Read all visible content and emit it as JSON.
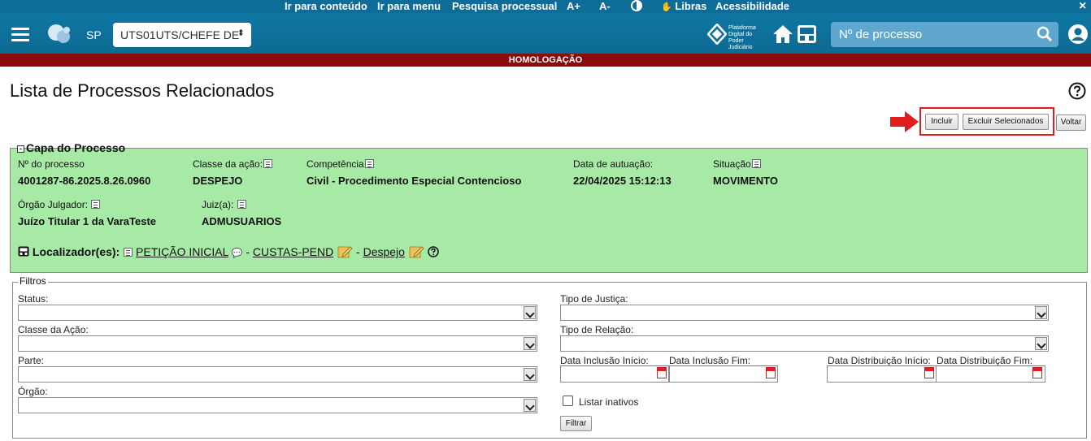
{
  "topnav": {
    "skip_content": "Ir para conteúdo",
    "skip_menu": "Ir para menu",
    "search_process": "Pesquisa processual",
    "font_increase": "A+",
    "font_decrease": "A-",
    "libras": "Libras",
    "accessibility": "Acessibilidade",
    "close": "×"
  },
  "header": {
    "state": "SP",
    "profile_select": "UTS01UTS/CHEFE DE",
    "pdpj_text": "Plataforma Digital do Poder Judiciário",
    "search_placeholder": "Nº de processo"
  },
  "banner": "HOMOLOGAÇÃO",
  "page": {
    "title": "Lista de Processos Relacionados"
  },
  "actions": {
    "include": "Incluir",
    "delete_selected": "Excluir Selecionados",
    "back": "Voltar"
  },
  "capa": {
    "legend": "Capa do Processo",
    "numero_label": "Nº do processo",
    "numero": "4001287-86.2025.8.26.0960",
    "classe_label": "Classe da ação:",
    "classe": "DESPEJO",
    "competencia_label": "Competência",
    "competencia": "Civil - Procedimento Especial Contencioso",
    "data_label": "Data de autuação:",
    "data": "22/04/2025 15:12:13",
    "situacao_label": "Situação",
    "situacao": "MOVIMENTO",
    "orgao_label": "Órgão Julgador:",
    "orgao": "Juízo Titular 1 da VaraTeste",
    "juiz_label": "Juiz(a):",
    "juiz": "ADMUSUARIOS",
    "localizador_label": "Localizador(es):",
    "localizadores": [
      "PETIÇÃO INICIAL",
      "CUSTAS-PEND",
      "Despejo"
    ],
    "sep": "-"
  },
  "filtros": {
    "legend": "Filtros",
    "status": "Status:",
    "classe_acao": "Classe da Ação:",
    "parte": "Parte:",
    "orgao": "Órgão:",
    "tipo_justica": "Tipo de Justiça:",
    "tipo_relacao": "Tipo de Relação:",
    "data_inclusao_inicio": "Data Inclusão Início:",
    "data_inclusao_fim": "Data Inclusão Fim:",
    "data_distribuicao_inicio": "Data Distribuição Início:",
    "data_distribuicao_fim": "Data Distribuição Fim:",
    "listar_inativos": "Listar inativos",
    "filtrar": "Filtrar"
  },
  "colors": {
    "topbar": "#0e6c98",
    "banner": "#8c0a0f",
    "capa_bg": "#a6eaa6",
    "highlight": "#e11c1c"
  }
}
